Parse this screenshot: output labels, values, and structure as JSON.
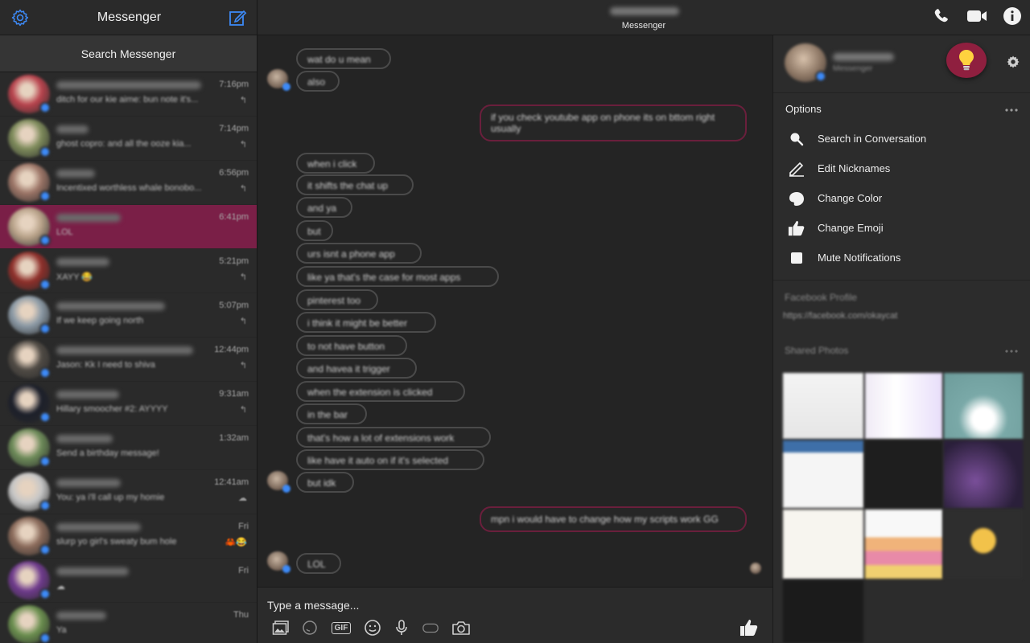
{
  "sidebar": {
    "title": "Messenger",
    "search_label": "Search Messenger",
    "conversations": [
      {
        "snippet": "ditch for our kie aime: bun note it's...",
        "time": "7:16pm",
        "status": "↰",
        "avatar_color": "#b8434d",
        "name_width": 180
      },
      {
        "snippet": "ghost copro: and all the ooze kia...",
        "time": "7:14pm",
        "status": "↰",
        "avatar_color": "#7d8a5a",
        "name_width": 40
      },
      {
        "snippet": "Incentixed worthless whale bonobo...",
        "time": "6:56pm",
        "status": "↰",
        "avatar_color": "#9b7466",
        "name_width": 48
      },
      {
        "snippet": "LOL",
        "time": "6:41pm",
        "status": "",
        "avatar_color": "#b7a188",
        "name_width": 80,
        "active": true
      },
      {
        "snippet": "XAYY 😂",
        "time": "5:21pm",
        "status": "↰",
        "avatar_color": "#8e2f2a",
        "name_width": 66
      },
      {
        "snippet": "If we keep going north",
        "time": "5:07pm",
        "status": "↰",
        "avatar_color": "#8c9aa6",
        "name_width": 135
      },
      {
        "snippet": "Jason: Kk I need to shiva",
        "time": "12:44pm",
        "status": "↰",
        "avatar_color": "#4f4a44",
        "name_width": 170
      },
      {
        "snippet": "Hillary smoocher #2: AYYYY",
        "time": "9:31am",
        "status": "↰",
        "avatar_color": "#1c1f2a",
        "name_width": 78
      },
      {
        "snippet": "Send a birthday message!",
        "time": "1:32am",
        "status": "",
        "avatar_color": "#6c8a58",
        "name_width": 70
      },
      {
        "snippet": "You: ya i'll call up my homie",
        "time": "12:41am",
        "status": "☁",
        "avatar_color": "#c7c7c7",
        "name_width": 80
      },
      {
        "snippet": "slurp yo girl's sweaty bum hole",
        "time": "Fri",
        "status": "🦀😂",
        "avatar_color": "#8a6a5a",
        "name_width": 105
      },
      {
        "snippet": "☁",
        "time": "Fri",
        "status": "",
        "avatar_color": "#6e3a8c",
        "name_width": 90
      },
      {
        "snippet": "Ya",
        "time": "Thu",
        "status": "",
        "avatar_color": "#6a8e4e",
        "name_width": 62
      }
    ]
  },
  "header": {
    "subtitle": "Messenger"
  },
  "chat": {
    "messages": [
      {
        "text": "wat do u mean",
        "dir": "in"
      },
      {
        "text": "also",
        "dir": "in"
      },
      {
        "text": "if you check youtube app on phone its on bttom right usually",
        "dir": "out"
      },
      {
        "text": "when i click",
        "dir": "in"
      },
      {
        "text": "it shifts the chat up",
        "dir": "in"
      },
      {
        "text": "and ya",
        "dir": "in"
      },
      {
        "text": "but",
        "dir": "in"
      },
      {
        "text": "urs isnt a phone app",
        "dir": "in"
      },
      {
        "text": "like ya that's the case for most apps",
        "dir": "in"
      },
      {
        "text": "pinterest too",
        "dir": "in"
      },
      {
        "text": "i think it might be better",
        "dir": "in"
      },
      {
        "text": "to not have button",
        "dir": "in"
      },
      {
        "text": "and havea it trigger",
        "dir": "in"
      },
      {
        "text": "when the extension is clicked",
        "dir": "in"
      },
      {
        "text": "in the bar",
        "dir": "in"
      },
      {
        "text": "that's how a lot of extensions work",
        "dir": "in"
      },
      {
        "text": "like have it auto on if it's selected",
        "dir": "in"
      },
      {
        "text": "but idk",
        "dir": "in"
      },
      {
        "text": "mpn i would have to change how my scripts work GG",
        "dir": "out"
      },
      {
        "text": "LOL",
        "dir": "in"
      }
    ]
  },
  "composer": {
    "placeholder": "Type a message...",
    "gif_label": "GIF"
  },
  "right_panel": {
    "profile_subtitle": "Messenger",
    "options_title": "Options",
    "options": [
      {
        "label": "Search in Conversation",
        "icon": "search-icon"
      },
      {
        "label": "Edit Nicknames",
        "icon": "pencil-icon"
      },
      {
        "label": "Change Color",
        "icon": "palette-icon"
      },
      {
        "label": "Change Emoji",
        "icon": "thumbs-up-icon"
      },
      {
        "label": "Mute Notifications",
        "icon": "checkbox-icon"
      }
    ],
    "profile_section_title": "Facebook Profile",
    "profile_url": "https://facebook.com/okaycat",
    "photos_title": "Shared Photos"
  },
  "colors": {
    "accent_active": "#7a1f47",
    "bulb": "#8f1f3f",
    "icon_blue": "#3d8af7",
    "outgoing_border": "#6a1f3c"
  }
}
